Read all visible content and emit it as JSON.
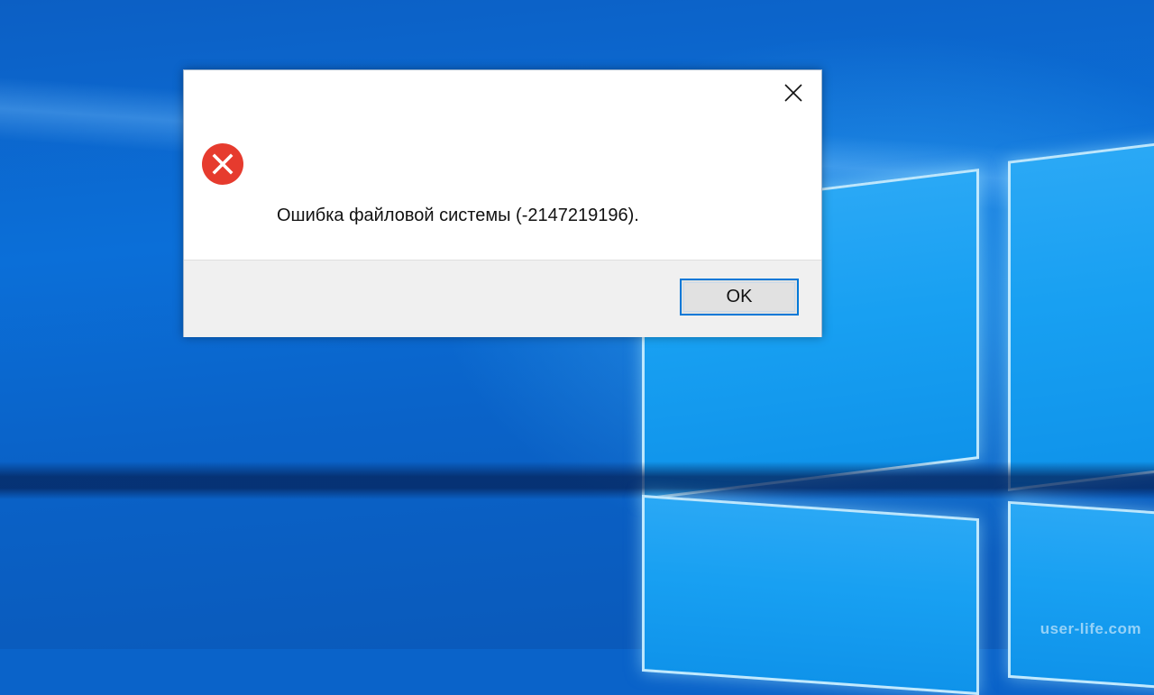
{
  "desktop": {
    "watermark": "user-life.com"
  },
  "dialog": {
    "title": "",
    "file_name": "",
    "message": "Ошибка файловой системы (-2147219196).",
    "ok_label": "OK",
    "icon": "error-icon",
    "close_icon": "close-icon",
    "error_color": "#e63b2e",
    "focus_color": "#0078d7"
  }
}
